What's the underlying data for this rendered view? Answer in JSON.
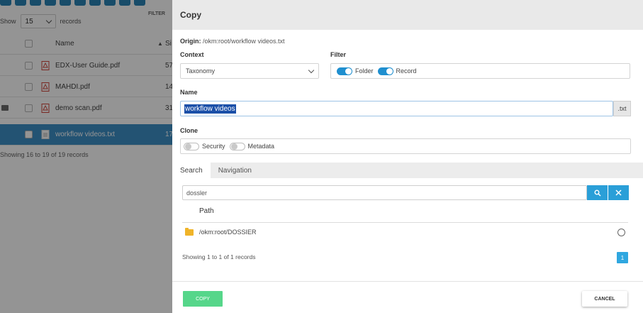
{
  "background": {
    "show_label": "Show",
    "page_size": "15",
    "records_label": "records",
    "filter_label": "FILTER",
    "column_name": "Name",
    "column_size_fragment": "Si",
    "rows": [
      {
        "name": "EDX-User Guide.pdf",
        "size": "57"
      },
      {
        "name": "MAHDI.pdf",
        "size": "14"
      },
      {
        "name": "demo scan.pdf",
        "size": "31"
      },
      {
        "name": "workflow videos.txt",
        "size": "17"
      }
    ],
    "showing": "Showing 16 to 19 of 19 records"
  },
  "modal": {
    "title": "Copy",
    "origin_label": "Origin:",
    "origin_path": "/okm:root/workflow videos.txt",
    "context_label": "Context",
    "context_value": "Taxonomy",
    "filter_label": "Filter",
    "filter_folder": "Folder",
    "filter_record": "Record",
    "name_label": "Name",
    "name_value": "workflow videos",
    "extension": ".txt",
    "clone_label": "Clone",
    "clone_security": "Security",
    "clone_metadata": "Metadata",
    "tabs": [
      {
        "label": "Search"
      },
      {
        "label": "Navigation"
      }
    ],
    "search_value": "dossler",
    "path_header": "Path",
    "result_path": "/okm:root/DOSSIER",
    "showing": "Showing 1 to 1 of 1 records",
    "page_number": "1",
    "copy_label": "COPY",
    "cancel_label": "CANCEL"
  },
  "colors": {
    "accent_blue": "#2a9fd8",
    "toggle_on": "#1f8fcf",
    "copy_green": "#56d68a",
    "folder_yellow": "#f0b429",
    "selected_row": "#3d8fc6"
  }
}
